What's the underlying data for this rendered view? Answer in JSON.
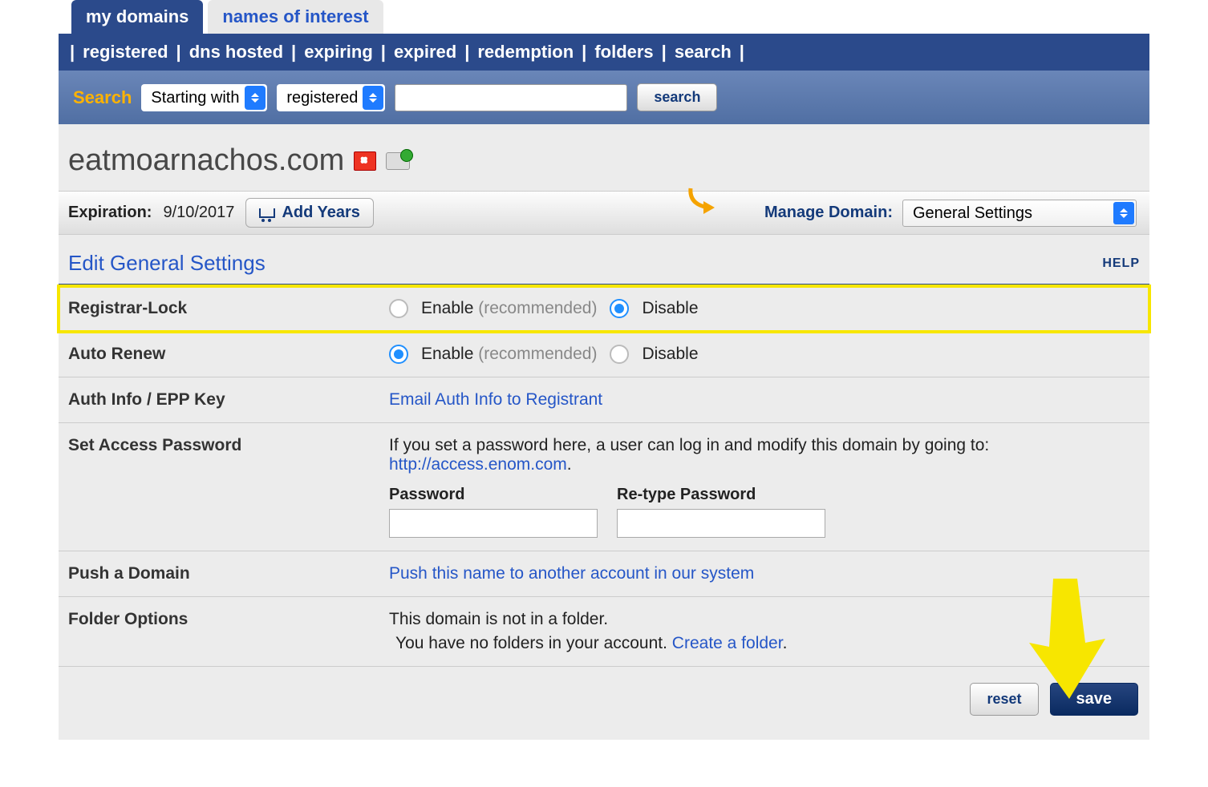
{
  "top_tabs": {
    "active": "my domains",
    "inactive": "names of interest"
  },
  "subnav": [
    "registered",
    "dns hosted",
    "expiring",
    "expired",
    "redemption",
    "folders",
    "search"
  ],
  "searchbar": {
    "label": "Search",
    "mode_options": [
      "Starting with"
    ],
    "mode_selected": "Starting with",
    "scope_options": [
      "registered"
    ],
    "scope_selected": "registered",
    "query": "",
    "button": "search"
  },
  "domain": {
    "name": "eatmoarnachos.com",
    "expiration_label": "Expiration:",
    "expiration_date": "9/10/2017",
    "add_years": "Add Years",
    "manage_label": "Manage Domain:",
    "manage_options": [
      "General Settings"
    ],
    "manage_selected": "General Settings"
  },
  "section": {
    "title": "Edit General Settings",
    "help": "HELP"
  },
  "rows": {
    "registrar_lock": {
      "label": "Registrar-Lock",
      "enable": "Enable",
      "rec": "(recommended)",
      "disable": "Disable",
      "selected": "disable"
    },
    "auto_renew": {
      "label": "Auto Renew",
      "enable": "Enable",
      "rec": "(recommended)",
      "disable": "Disable",
      "selected": "enable"
    },
    "auth_info": {
      "label": "Auth Info / EPP Key",
      "link": "Email Auth Info to Registrant"
    },
    "set_pw": {
      "label": "Set Access Password",
      "desc_pre": "If you set a password here, a user can log in and modify this domain by going to: ",
      "desc_link": "http://access.enom.com",
      "desc_post": ".",
      "pw_label": "Password",
      "pw2_label": "Re-type Password"
    },
    "push": {
      "label": "Push a Domain",
      "link": "Push this name to another account in our system"
    },
    "folders": {
      "label": "Folder Options",
      "line1": "This domain is not in a folder.",
      "line2_pre": "You have no folders in your account. ",
      "line2_link": "Create a folder",
      "line2_post": "."
    }
  },
  "footer": {
    "reset": "reset",
    "save": "save"
  }
}
